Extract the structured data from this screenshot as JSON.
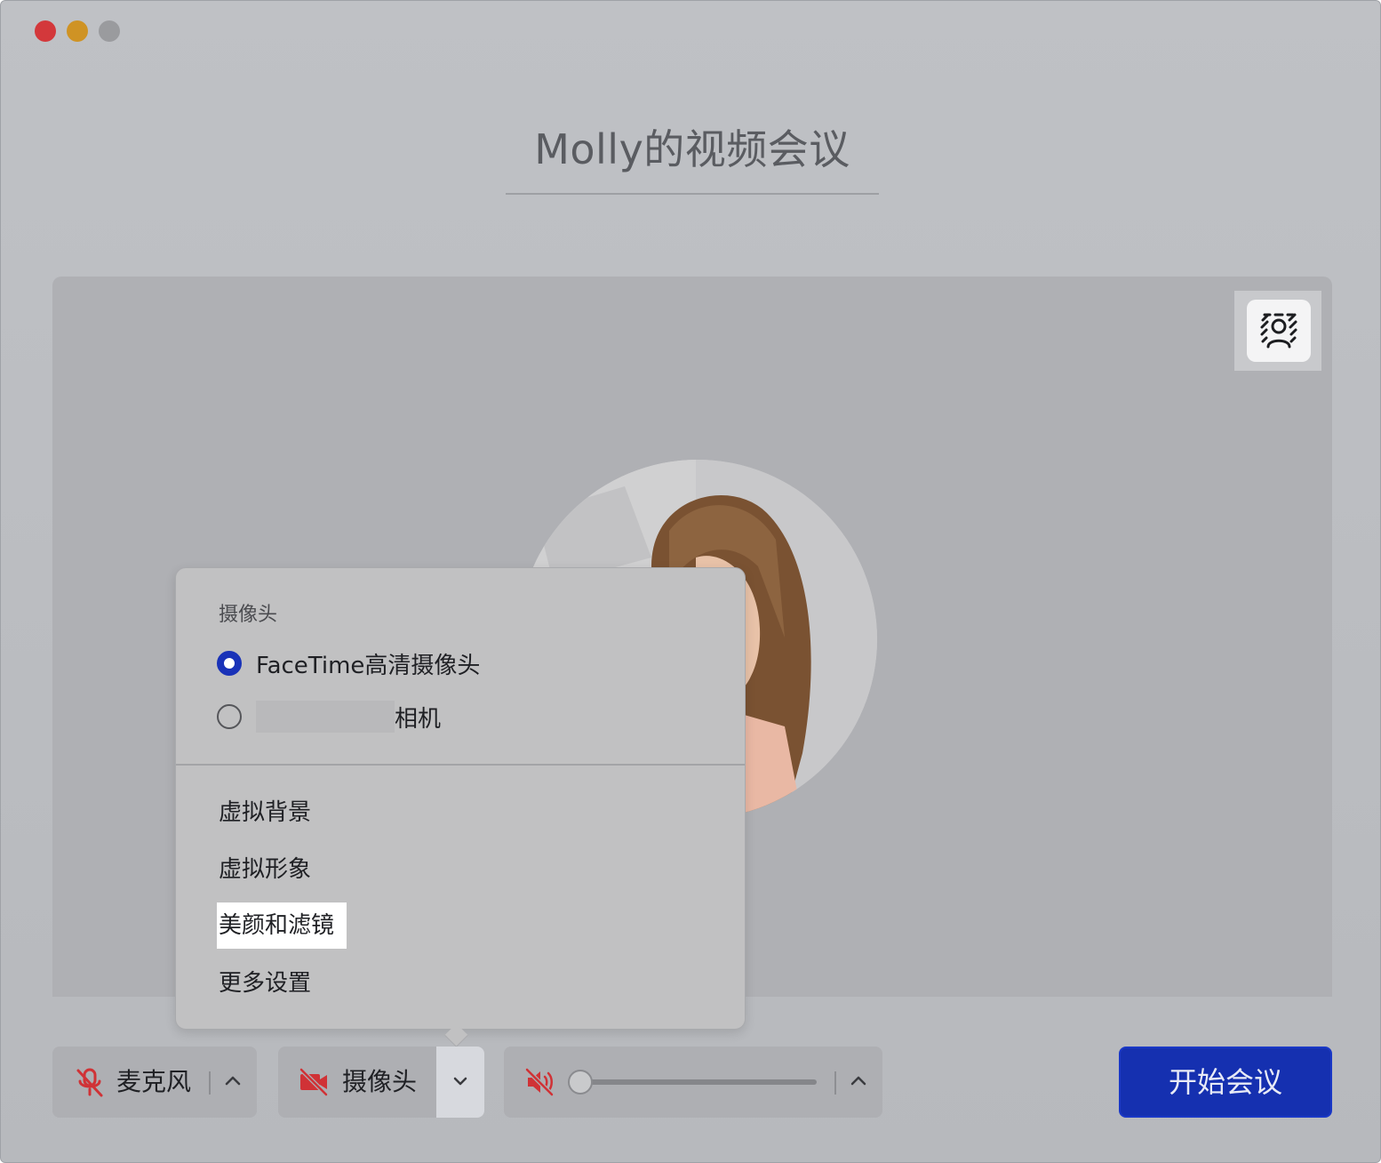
{
  "window": {
    "controls": [
      "close",
      "minimize",
      "maximize"
    ]
  },
  "meeting": {
    "title": "Molly的视频会议"
  },
  "preview": {
    "background_toggle_icon": "virtual-background-person-icon",
    "avatar": "user-photo"
  },
  "camera_menu": {
    "heading": "摄像头",
    "devices": [
      {
        "label": "FaceTime高清摄像头",
        "selected": true
      },
      {
        "label": "相机",
        "selected": false
      }
    ],
    "items": [
      "虚拟背景",
      "虚拟形象",
      "美颜和滤镜",
      "更多设置"
    ],
    "highlighted_item": "美颜和滤镜"
  },
  "toolbar": {
    "mic_label": "麦克风",
    "mic_icon": "microphone-muted-icon",
    "camera_label": "摄像头",
    "camera_icon": "camera-off-icon",
    "speaker_icon": "speaker-muted-icon",
    "volume_level": 0,
    "start_label": "开始会议"
  },
  "colors": {
    "accent": "#1530b0",
    "muted_red": "#d03236",
    "radio_selected": "#1932b8"
  }
}
